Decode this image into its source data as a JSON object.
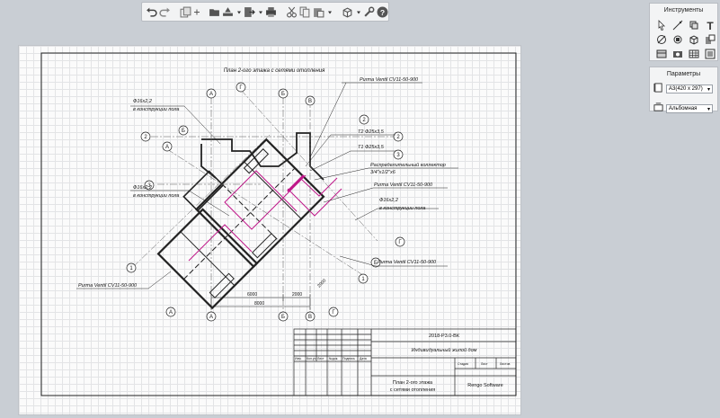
{
  "toolbar": {
    "icons": [
      "undo-icon",
      "redo-icon",
      "copy-view-icon",
      "plus-icon",
      "open-folder-icon",
      "print-setup-icon",
      "dropdown-icon",
      "export-icon",
      "dropdown-icon",
      "print-icon",
      "cut-icon",
      "copy-icon",
      "paste-icon",
      "dropdown-icon",
      "view-3d-icon",
      "dropdown-icon",
      "wrench-icon",
      "help-icon"
    ]
  },
  "tools_panel": {
    "title": "Инструменты",
    "tools": [
      "cursor-icon",
      "line-icon",
      "rectangle-icon",
      "text-icon",
      "hatch-icon",
      "rotate-icon",
      "box-icon",
      "shape-icon",
      "section-icon",
      "stamp-icon",
      "table-icon",
      "list-icon"
    ]
  },
  "params_panel": {
    "title": "Параметры",
    "sheet_size": "A3(420 x 297)",
    "orientation": "Альбомная"
  },
  "drawing": {
    "title": "План 2-ого этажа с сетями отопления",
    "labels": {
      "l1a": "Ф16х2,2",
      "l1b": "в конструкции пола",
      "l2a": "Ф16х2,2",
      "l2b": "в конструкции пола",
      "l3a": "Ф16х2,2",
      "l3b": "в конструкции пола",
      "purma_top": "Purma Ventil CV11-50-900",
      "t2": "Т2 Ф25х3,5",
      "t1": "Т1 Ф25х3,5",
      "collector_a": "Распределительный коллектор",
      "collector_b": "3/4\"х1/2\"х6",
      "purma_mid": "Purma Ventil CV11-50-900",
      "purma_right": "Purma Ventil CV11-50-900",
      "purma_left": "Purma Ventil CV11-50-900"
    },
    "axes": {
      "a": "А",
      "b": "Б",
      "v": "В",
      "g": "Г",
      "n1": "1",
      "n2": "2",
      "n3": "3"
    },
    "dims": {
      "d6000a": "6000",
      "d2000": "2000",
      "d8000": "8000",
      "dim_rot": "2000"
    },
    "stamp": {
      "code": "2018-Р3.0-ВК",
      "project": "Индивидуальный жилой дом",
      "sheet_title_a": "План 2-ого этажа",
      "sheet_title_b": "с сетями отопления",
      "company": "Rengo Software",
      "stage": "Стадия",
      "sheet": "Лист",
      "sheets": "Листов",
      "col1": "Изм.",
      "col2": "Кол.уч",
      "col3": "Лист",
      "col4": "№док.",
      "col5": "Подпись",
      "col6": "Дата"
    }
  }
}
